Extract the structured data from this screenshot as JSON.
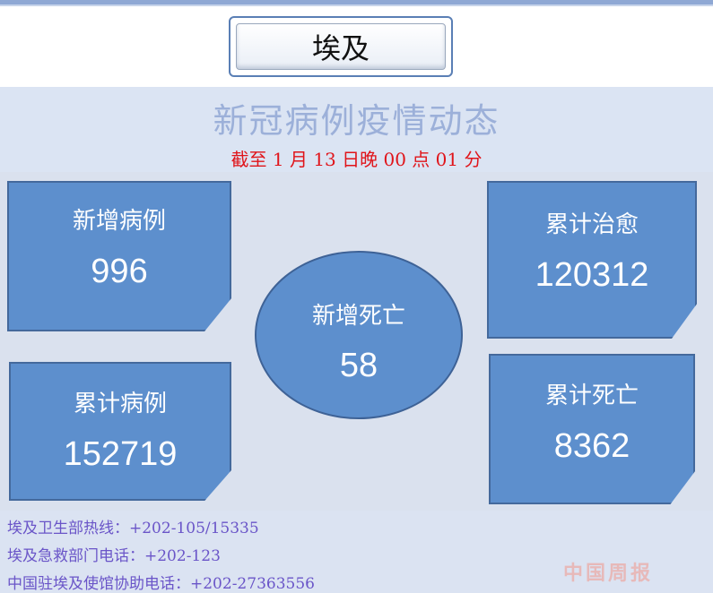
{
  "title": "埃及",
  "heading": "新冠病例疫情动态",
  "subheading": "截至 1 月 13 日晚 00 点 01 分",
  "stats": {
    "new_cases": {
      "label": "新增病例",
      "value": "996"
    },
    "total_cases": {
      "label": "累计病例",
      "value": "152719"
    },
    "new_deaths": {
      "label": "新增死亡",
      "value": "58"
    },
    "recovered": {
      "label": "累计治愈",
      "value": "120312"
    },
    "total_deaths": {
      "label": "累计死亡",
      "value": "8362"
    }
  },
  "contacts": [
    "埃及卫生部热线：+202-105/15335",
    "埃及急救部门电话：+202-123",
    "中国驻埃及使馆协助电话：+202-27363556"
  ],
  "watermark": "中国周报",
  "colors": {
    "card": "#5d8fcd",
    "heading": "#9cb0d9",
    "subheading": "#e0141a",
    "contact_text": "#6a55c8"
  }
}
